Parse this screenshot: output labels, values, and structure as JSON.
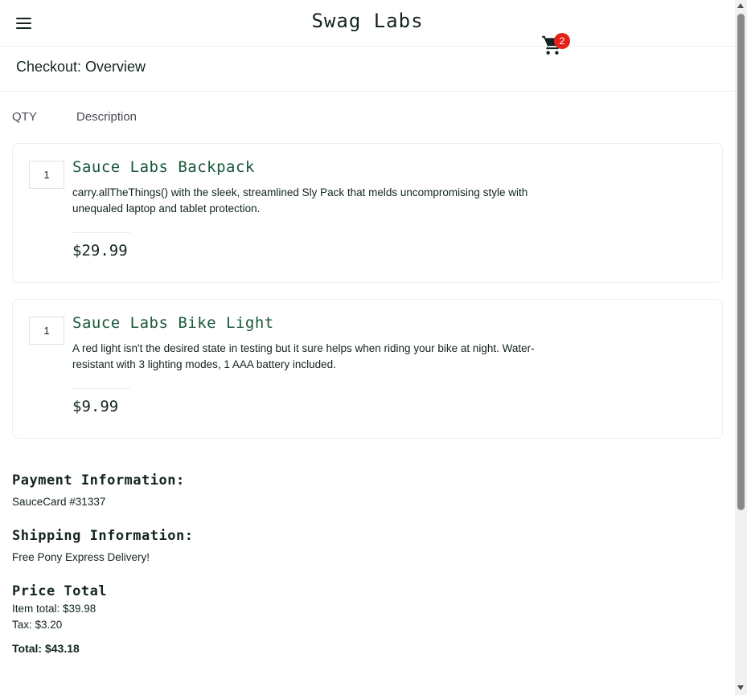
{
  "header": {
    "app_title": "Swag Labs",
    "menu_icon": "hamburger-menu-icon",
    "cart_icon": "shopping-cart-icon",
    "cart_count": "2"
  },
  "page": {
    "title": "Checkout: Overview"
  },
  "columns": {
    "qty": "QTY",
    "description": "Description"
  },
  "items": [
    {
      "qty": "1",
      "name": "Sauce Labs Backpack",
      "description": "carry.allTheThings() with the sleek, streamlined Sly Pack that melds uncompromising style with unequaled laptop and tablet protection.",
      "price": "$29.99"
    },
    {
      "qty": "1",
      "name": "Sauce Labs Bike Light",
      "description": "A red light isn't the desired state in testing but it sure helps when riding your bike at night. Water-resistant with 3 lighting modes, 1 AAA battery included.",
      "price": "$9.99"
    }
  ],
  "summary": {
    "payment_label": "Payment Information:",
    "payment_value": "SauceCard #31337",
    "shipping_label": "Shipping Information:",
    "shipping_value": "Free Pony Express Delivery!",
    "price_total_label": "Price Total",
    "item_total": "Item total: $39.98",
    "tax": "Tax: $3.20",
    "total": "Total: $43.18"
  },
  "colors": {
    "item_name": "#18583a",
    "badge": "#e2231a",
    "text": "#132322"
  }
}
